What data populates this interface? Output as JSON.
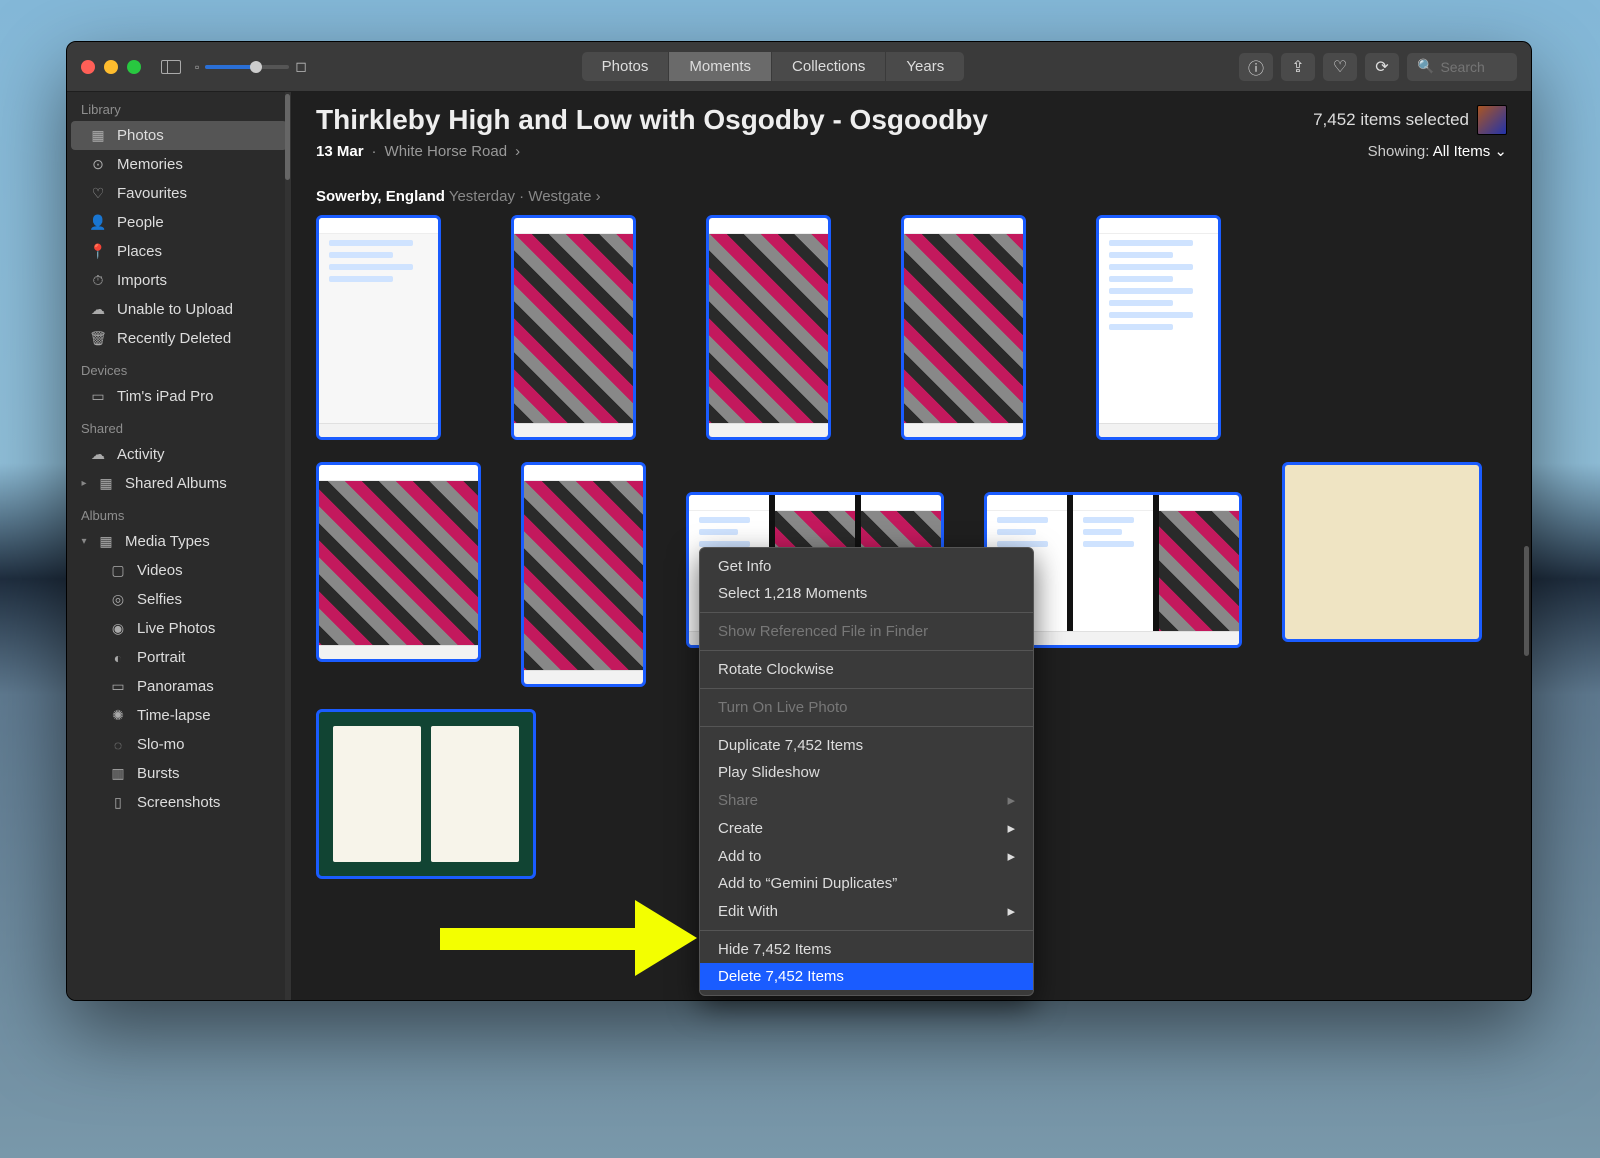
{
  "titlebar": {
    "tabs": [
      "Photos",
      "Moments",
      "Collections",
      "Years"
    ],
    "active_tab_index": 1,
    "search_placeholder": "Search"
  },
  "sidebar": {
    "groups": [
      {
        "name": "library",
        "label": "Library",
        "items": [
          {
            "icon": "▦",
            "label": "Photos",
            "name": "photos",
            "active": true
          },
          {
            "icon": "⊙",
            "label": "Memories",
            "name": "memories"
          },
          {
            "icon": "♡",
            "label": "Favourites",
            "name": "favourites"
          },
          {
            "icon": "👤",
            "label": "People",
            "name": "people"
          },
          {
            "icon": "📍",
            "label": "Places",
            "name": "places"
          },
          {
            "icon": "⏱",
            "label": "Imports",
            "name": "imports"
          },
          {
            "icon": "☁",
            "label": "Unable to Upload",
            "name": "unable-upload"
          },
          {
            "icon": "🗑",
            "label": "Recently Deleted",
            "name": "recently-deleted"
          }
        ]
      },
      {
        "name": "devices",
        "label": "Devices",
        "items": [
          {
            "icon": "▭",
            "label": "Tim's iPad Pro",
            "name": "tims-ipad-pro"
          }
        ]
      },
      {
        "name": "shared",
        "label": "Shared",
        "items": [
          {
            "icon": "☁",
            "label": "Activity",
            "name": "activity"
          },
          {
            "icon": "▦",
            "label": "Shared Albums",
            "name": "shared-albums",
            "disclosure": "▸"
          }
        ]
      },
      {
        "name": "albums",
        "label": "Albums",
        "items": [
          {
            "icon": "▦",
            "label": "Media Types",
            "name": "media-types",
            "disclosure": "▾",
            "children": [
              {
                "icon": "▢",
                "label": "Videos",
                "name": "videos"
              },
              {
                "icon": "◎",
                "label": "Selfies",
                "name": "selfies"
              },
              {
                "icon": "◉",
                "label": "Live Photos",
                "name": "live-photos"
              },
              {
                "icon": "◐",
                "label": "Portrait",
                "name": "portrait"
              },
              {
                "icon": "▭",
                "label": "Panoramas",
                "name": "panoramas"
              },
              {
                "icon": "✺",
                "label": "Time-lapse",
                "name": "time-lapse"
              },
              {
                "icon": "◌",
                "label": "Slo-mo",
                "name": "slo-mo"
              },
              {
                "icon": "▥",
                "label": "Bursts",
                "name": "bursts"
              },
              {
                "icon": "▯",
                "label": "Screenshots",
                "name": "screenshots"
              }
            ]
          }
        ]
      }
    ]
  },
  "header": {
    "title": "Thirkleby High and Low with Osgodby - Osgoodby",
    "selected_text": "7,452 items selected",
    "date": "13 Mar",
    "place": "White Horse Road",
    "showing_label": "Showing:",
    "showing_value": "All Items"
  },
  "group": {
    "location_bold": "Sowerby, England",
    "location_sub": "Yesterday",
    "location_trail": "Westgate"
  },
  "context_menu": {
    "items": [
      {
        "label": "Get Info"
      },
      {
        "label": "Select 1,218 Moments"
      },
      {
        "sep": true
      },
      {
        "label": "Show Referenced File in Finder",
        "disabled": true
      },
      {
        "sep": true
      },
      {
        "label": "Rotate Clockwise"
      },
      {
        "sep": true
      },
      {
        "label": "Turn On Live Photo",
        "disabled": true
      },
      {
        "sep": true
      },
      {
        "label": "Duplicate 7,452 Items"
      },
      {
        "label": "Play Slideshow"
      },
      {
        "label": "Share",
        "disabled": true,
        "submenu": true
      },
      {
        "label": "Create",
        "submenu": true
      },
      {
        "label": "Add to",
        "submenu": true
      },
      {
        "label": "Add to “Gemini Duplicates”"
      },
      {
        "label": "Edit With",
        "submenu": true
      },
      {
        "sep": true
      },
      {
        "label": "Hide 7,452 Items"
      },
      {
        "label": "Delete 7,452 Items",
        "highlight": true
      }
    ]
  }
}
